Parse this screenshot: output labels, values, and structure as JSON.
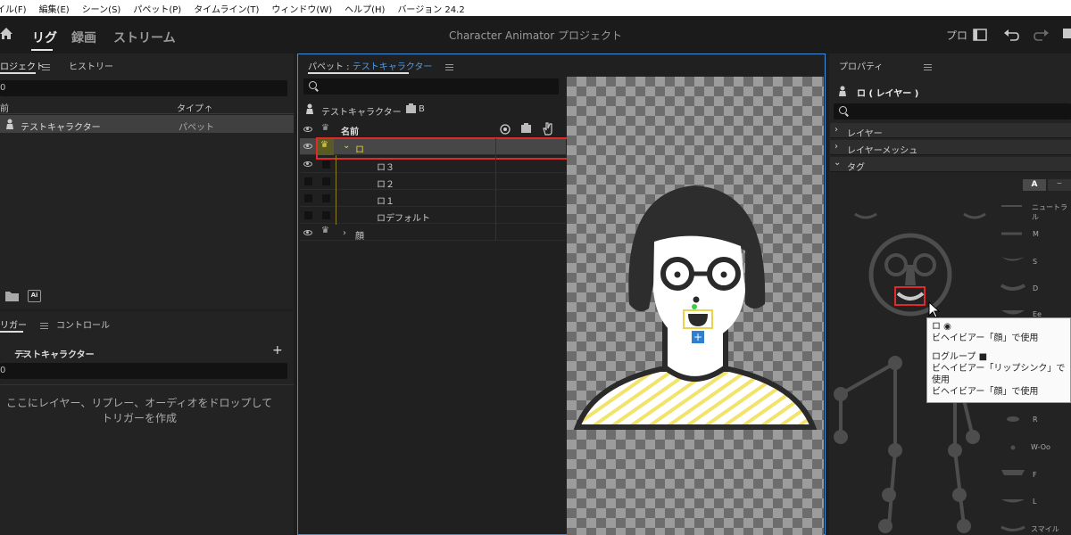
{
  "menu": [
    "イル(F)",
    "編集(E)",
    "シーン(S)",
    "パペット(P)",
    "タイムライン(T)",
    "ウィンドウ(W)",
    "ヘルプ(H)",
    "バージョン 24.2"
  ],
  "appbar": {
    "nav": [
      "リグ",
      "録画",
      "ストリーム"
    ],
    "title": "Character Animator プロジェクト",
    "right_label": "プロ"
  },
  "project": {
    "tabs": [
      "ロジェクト",
      "ヒストリー"
    ],
    "search_value": "0",
    "columns": [
      "前",
      "タイプ"
    ],
    "rows": [
      {
        "name": "テストキャラクター",
        "type": "パペット"
      }
    ]
  },
  "trigger": {
    "tabs": [
      "リガー",
      "コントロール"
    ],
    "puppet": "テストキャラクター",
    "add": "+",
    "search_value": "0",
    "drop_hint": "ここにレイヤー、リプレー、オーディオをドロップしてトリガーを作成"
  },
  "puppet": {
    "tab_prefix": "パペット : ",
    "tab_name": "テストキャラクター",
    "puppet_name": "テストキャラクター",
    "b_label": "B",
    "name_header": "名前",
    "layers": [
      {
        "name": "ロ",
        "level": 0,
        "expanded": true,
        "selected": true
      },
      {
        "name": "ロ３",
        "level": 1
      },
      {
        "name": "ロ２",
        "level": 1
      },
      {
        "name": "ロ１",
        "level": 1
      },
      {
        "name": "ロデフォルト",
        "level": 1
      },
      {
        "name": "顔",
        "level": 0,
        "expanded": false
      }
    ]
  },
  "properties": {
    "tab": "プロパティ",
    "layer_title": "ロ ( レイヤー )",
    "sections": [
      "レイヤー",
      "レイヤーメッシュ",
      "タグ"
    ],
    "tag_buttons": [
      "A",
      "⌣"
    ],
    "visemes": [
      "ニュートラル",
      "M",
      "S",
      "D",
      "Ee",
      "R",
      "W-Oo",
      "F",
      "L",
      "スマイル"
    ],
    "tooltip": {
      "line1": "ロ ◉",
      "line2": "ビヘイビアー「顔」で使用",
      "line3": "ログループ ■",
      "line4": "ビヘイビアー「リップシンク」で使用",
      "line5": "ビヘイビアー「顔」で使用"
    }
  },
  "colors": {
    "accent": "#3d8fe0",
    "highlight": "#e02a2a",
    "crown": "#e8d34a"
  }
}
